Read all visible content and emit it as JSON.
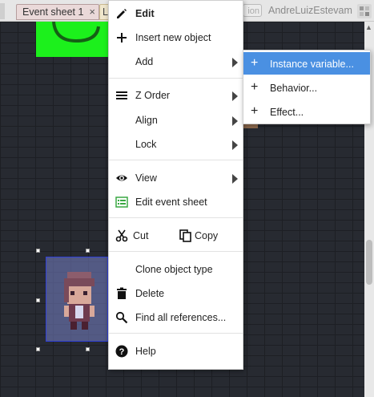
{
  "tabs": {
    "event_sheet": "Event sheet 1",
    "close_glyph": "×",
    "layout_tab_partial": "L"
  },
  "user": {
    "tag_partial": "ion",
    "name": "AndreLuizEstevam"
  },
  "menu": {
    "edit": "Edit",
    "insert": "Insert new object",
    "add": "Add",
    "zorder": "Z Order",
    "align": "Align",
    "lock": "Lock",
    "view": "View",
    "edit_event_sheet": "Edit event sheet",
    "cut": "Cut",
    "copy": "Copy",
    "clone": "Clone object type",
    "delete": "Delete",
    "find_refs": "Find all references...",
    "help": "Help"
  },
  "submenu": {
    "instance_variable": "Instance variable...",
    "behavior": "Behavior...",
    "effect": "Effect..."
  },
  "colors": {
    "highlight": "#4a90e2",
    "green_sprite": "#1cf01c",
    "edit_event_icon": "#3aa843"
  },
  "icons": {
    "edit": "pencil-icon",
    "insert": "plus-icon",
    "zorder": "list-lines-icon",
    "view": "eye-icon",
    "edit_event_sheet": "event-sheet-icon",
    "cut": "scissors-icon",
    "copy": "copy-icon",
    "delete": "trash-icon",
    "find": "search-icon",
    "help": "help-icon"
  }
}
